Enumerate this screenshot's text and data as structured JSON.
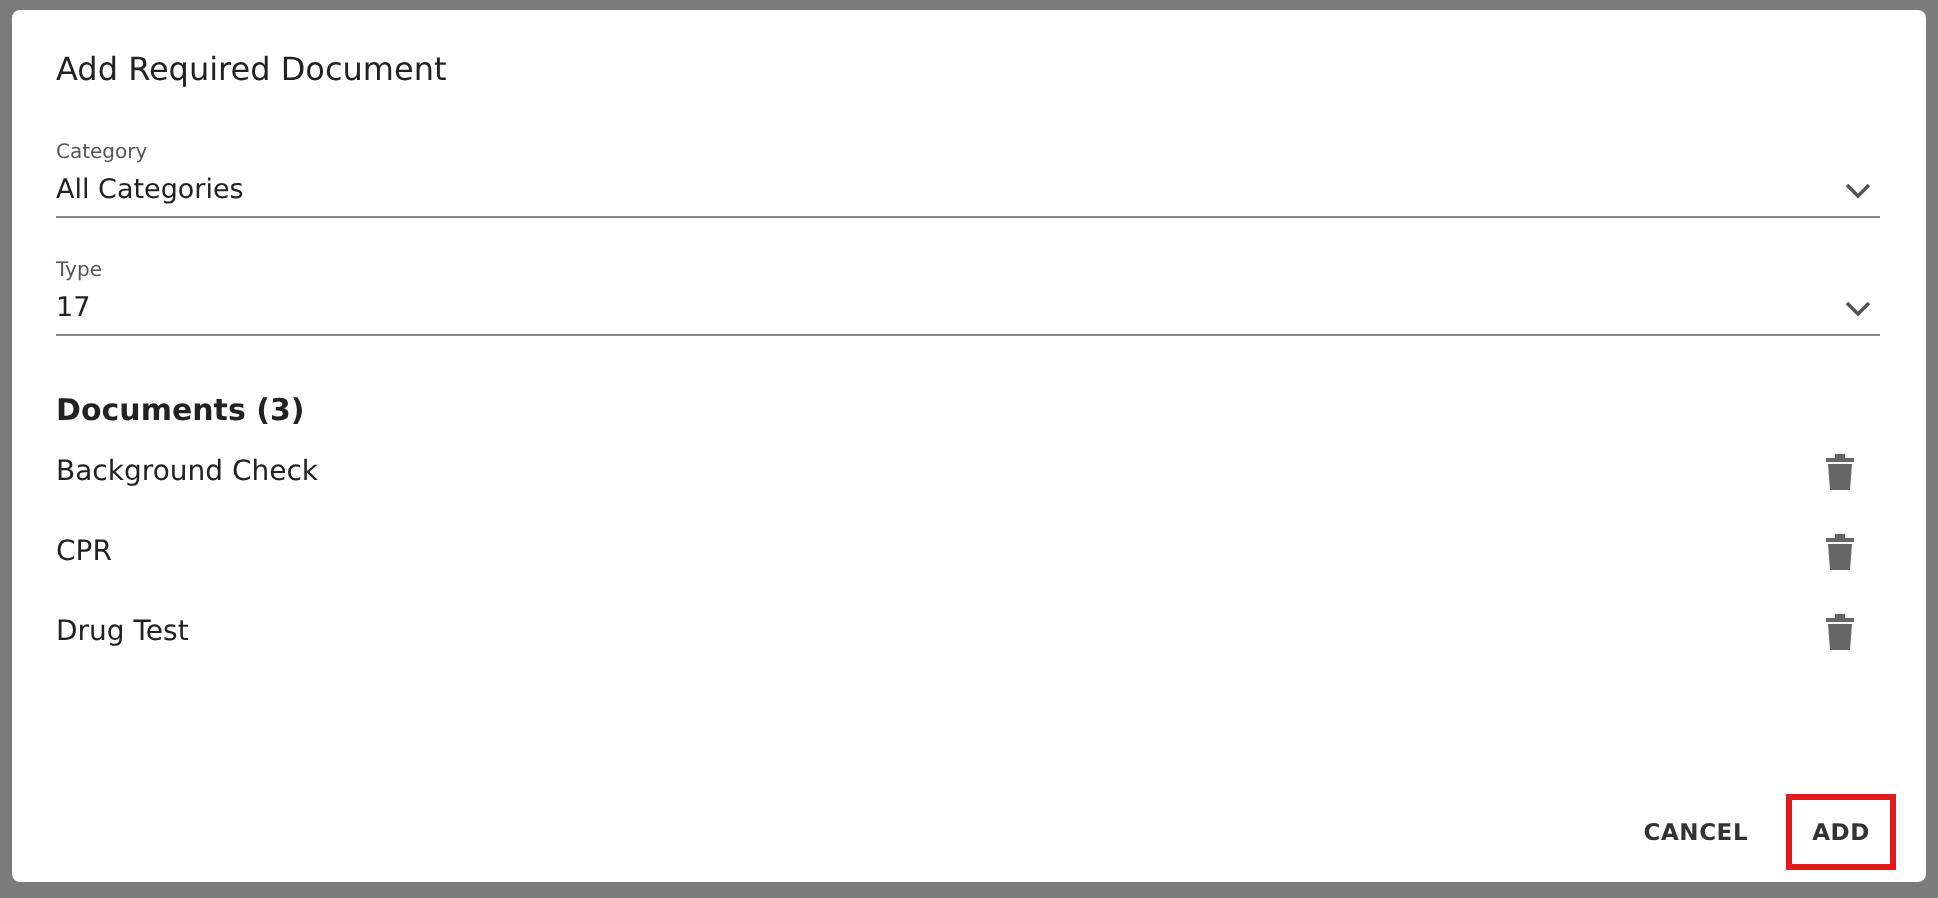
{
  "dialog": {
    "title": "Add Required Document"
  },
  "fields": [
    {
      "label": "Category",
      "value": "All Categories"
    },
    {
      "label": "Type",
      "value": "17"
    }
  ],
  "documents": {
    "heading": "Documents (3)",
    "items": [
      "Background Check",
      "CPR",
      "Drug Test"
    ]
  },
  "buttons": [
    {
      "label": "CANCEL",
      "highlighted": false
    },
    {
      "label": "ADD",
      "highlighted": true
    }
  ]
}
